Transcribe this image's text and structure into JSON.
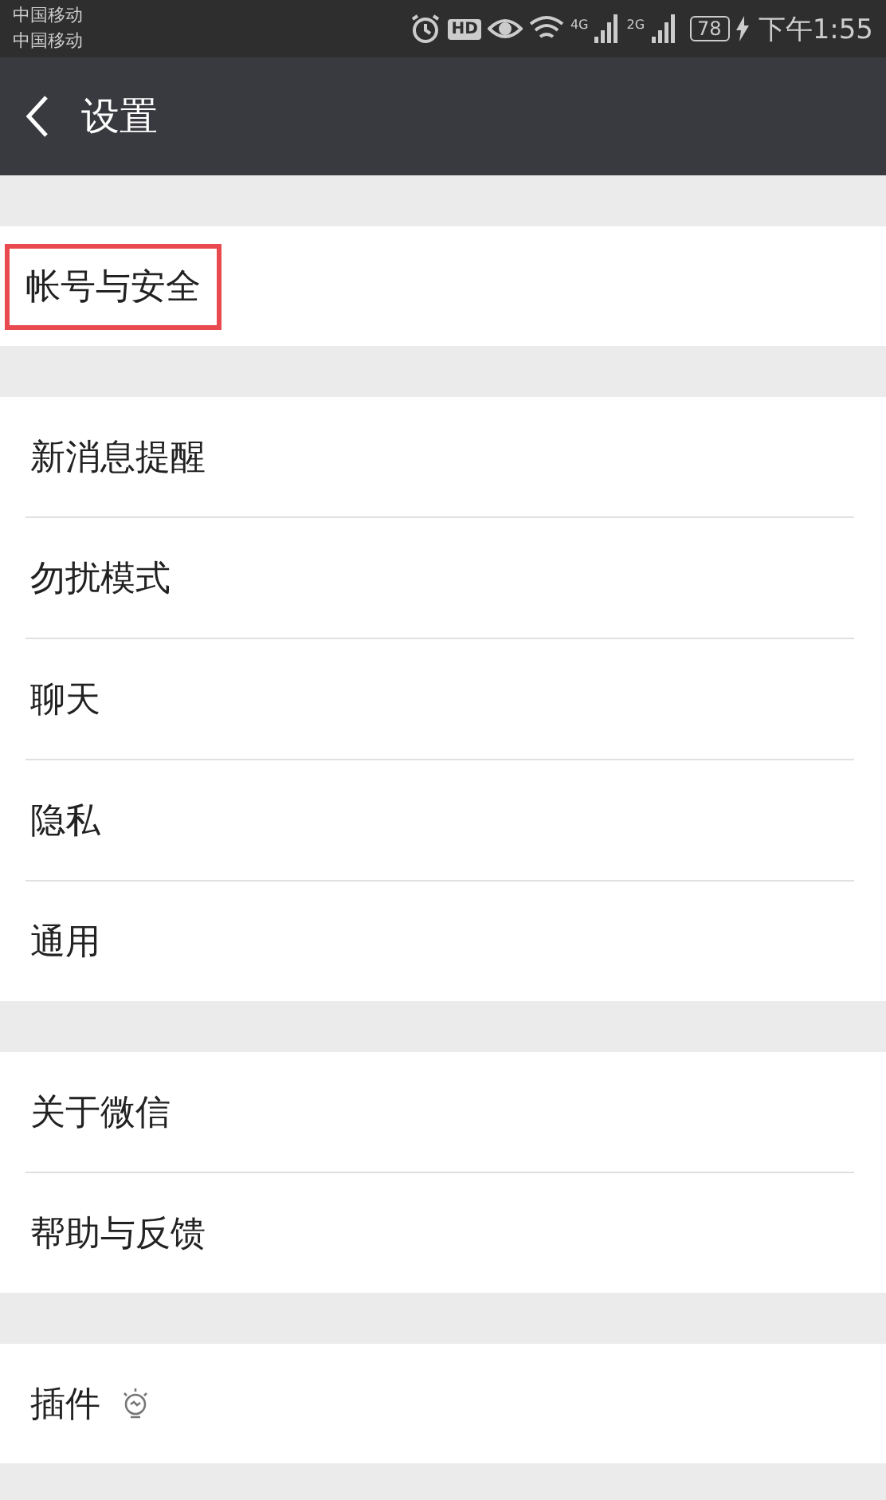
{
  "status_bar": {
    "carriers": [
      "中国移动",
      "中国移动"
    ],
    "hd": "HD",
    "networks": [
      "4G",
      "2G"
    ],
    "battery": "78",
    "time": "下午1:55"
  },
  "header": {
    "title": "设置"
  },
  "sections": [
    {
      "items": [
        {
          "label": "帐号与安全",
          "kind": "plain",
          "highlighted": true
        }
      ]
    },
    {
      "items": [
        {
          "label": "新消息提醒",
          "kind": "plain",
          "highlighted": false
        },
        {
          "label": "勿扰模式",
          "kind": "plain",
          "highlighted": false
        },
        {
          "label": "聊天",
          "kind": "plain",
          "highlighted": false
        },
        {
          "label": "隐私",
          "kind": "plain",
          "highlighted": false
        },
        {
          "label": "通用",
          "kind": "plain",
          "highlighted": false
        }
      ]
    },
    {
      "items": [
        {
          "label": "关于微信",
          "kind": "plain",
          "highlighted": false
        },
        {
          "label": "帮助与反馈",
          "kind": "plain",
          "highlighted": false
        }
      ]
    },
    {
      "items": [
        {
          "label": "插件",
          "kind": "with-bulb",
          "highlighted": false
        }
      ]
    }
  ]
}
